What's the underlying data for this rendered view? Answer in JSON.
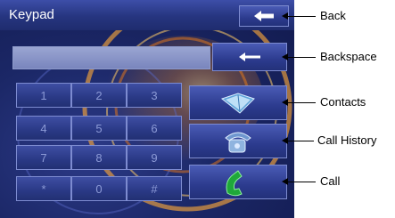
{
  "screen": {
    "title": "Keypad",
    "back_icon": "arrow-left-icon",
    "backspace_icon": "arrow-left-icon",
    "number_display": "",
    "keys": [
      "1",
      "2",
      "3",
      "4",
      "5",
      "6",
      "7",
      "8",
      "9",
      "*",
      "0",
      "#"
    ],
    "actions": [
      {
        "name": "contacts",
        "icon": "contacts-book-icon"
      },
      {
        "name": "call-history",
        "icon": "phone-handset-icon"
      },
      {
        "name": "call",
        "icon": "green-handset-icon"
      }
    ]
  },
  "callouts": {
    "back": "Back",
    "backspace": "Backspace",
    "contacts": "Contacts",
    "call_history": "Call History",
    "call": "Call"
  },
  "colors": {
    "title_bar": "#26357f",
    "background": "#1b2766",
    "key_text": "#8c9ad6",
    "call_icon": "#1fa83a",
    "swirl": "#f08a1c"
  }
}
